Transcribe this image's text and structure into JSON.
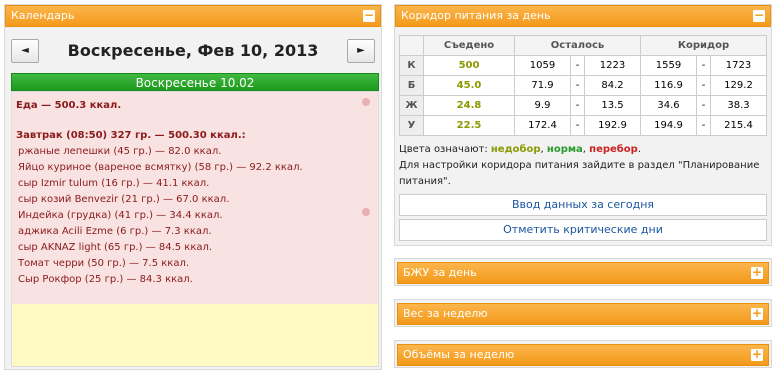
{
  "calendar": {
    "title": "Календарь",
    "toggle": "−",
    "prev_label": "◄",
    "next_label": "►",
    "date": "Воскресенье, Фев 10, 2013",
    "day_header": "Воскресенье 10.02",
    "food_total": "Еда — 500.3 ккал.",
    "meal_title": "Завтрак (08:50) 327 гр. — 500.30 ккал.:",
    "items": [
      "ржаные лепешки (45 гр.) — 82.0 ккал.",
      "Яйцо куриное (вареное всмятку) (58 гр.) — 92.2 ккал.",
      "сыр Izmir tulum (16 гр.) — 41.1 ккал.",
      "сыр козий Benvezir (21 гр.) — 67.0 ккал.",
      "Индейка (грудка) (41 гр.) — 34.4 ккал.",
      "аджика Acili Ezme (6 гр.) — 7.3 ккал.",
      "сыр AKNAZ light (65 гр.) — 84.5 ккал.",
      "Томат черри (50 гр.) — 7.5 ккал.",
      "Сыр Рокфор (25 гр.) — 84.3 ккал."
    ]
  },
  "corridor": {
    "title": "Коридор питания за день",
    "toggle": "−",
    "headers": [
      "",
      "Съедено",
      "Осталось",
      "Коридор"
    ],
    "rows": [
      {
        "label": "К",
        "eaten": "500",
        "left_min": "1059",
        "left_max": "1223",
        "corr_min": "1559",
        "corr_max": "1723"
      },
      {
        "label": "Б",
        "eaten": "45.0",
        "left_min": "71.9",
        "left_max": "84.2",
        "corr_min": "116.9",
        "corr_max": "129.2"
      },
      {
        "label": "Ж",
        "eaten": "24.8",
        "left_min": "9.9",
        "left_max": "13.5",
        "corr_min": "34.6",
        "corr_max": "38.3"
      },
      {
        "label": "У",
        "eaten": "22.5",
        "left_min": "172.4",
        "left_max": "192.9",
        "corr_min": "194.9",
        "corr_max": "215.4"
      }
    ],
    "dash": "-",
    "legend_prefix": "Цвета означают:",
    "legend_under": "недобор",
    "legend_norm": "норма",
    "legend_over": "перебор",
    "legend_sep1": ",",
    "legend_sep2": ",",
    "legend_end": ".",
    "hint": "Для настройки коридора питания зайдите в раздел \"Планирование питания\".",
    "btn_today": "Ввод данных за сегодня",
    "btn_critical": "Отметить критические дни",
    "colors": {
      "under": "#8a9a00",
      "norm": "#2a9a2a",
      "over": "#cc2222"
    }
  },
  "collapsed_panels": [
    {
      "title": "БЖУ за день",
      "toggle": "+"
    },
    {
      "title": "Вес за неделю",
      "toggle": "+"
    },
    {
      "title": "Объёмы за неделю",
      "toggle": "+"
    }
  ]
}
